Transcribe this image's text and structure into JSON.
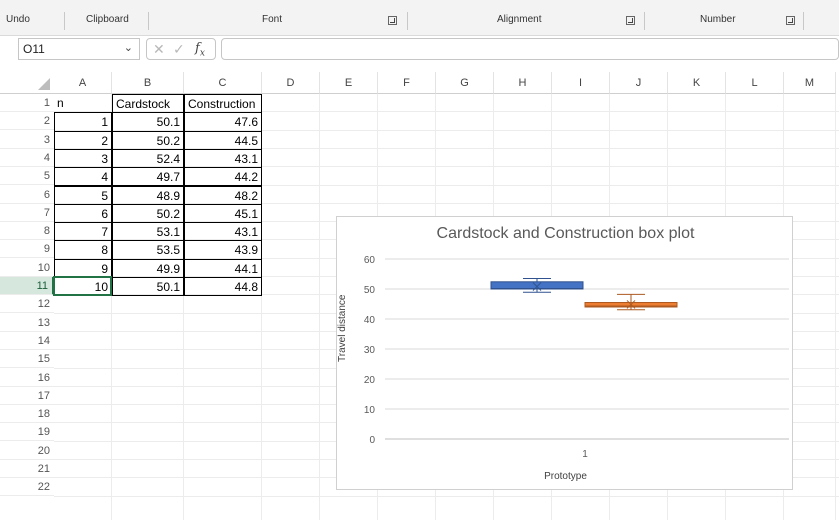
{
  "ribbon": {
    "groups": [
      "Undo",
      "Clipboard",
      "Font",
      "Alignment",
      "Number"
    ]
  },
  "formula_bar": {
    "name_box": "O11",
    "fx_label": "fx",
    "formula": ""
  },
  "columns": [
    "A",
    "B",
    "C",
    "D",
    "E",
    "F",
    "G",
    "H",
    "I",
    "J",
    "K",
    "L",
    "M"
  ],
  "rows": [
    "1",
    "2",
    "3",
    "4",
    "5",
    "6",
    "7",
    "8",
    "9",
    "10",
    "11",
    "12",
    "13",
    "14",
    "15",
    "16",
    "17",
    "18",
    "19",
    "20",
    "21",
    "22"
  ],
  "active_row": "11",
  "table": {
    "headers": [
      "n",
      "Cardstock",
      "Construction"
    ],
    "rows": [
      [
        "1",
        "50.1",
        "47.6"
      ],
      [
        "2",
        "50.2",
        "44.5"
      ],
      [
        "3",
        "52.4",
        "43.1"
      ],
      [
        "4",
        "49.7",
        "44.2"
      ],
      [
        "5",
        "48.9",
        "48.2"
      ],
      [
        "6",
        "50.2",
        "45.1"
      ],
      [
        "7",
        "53.1",
        "43.1"
      ],
      [
        "8",
        "53.5",
        "43.9"
      ],
      [
        "9",
        "49.9",
        "44.1"
      ],
      [
        "10",
        "50.1",
        "44.8"
      ]
    ]
  },
  "chart_data": {
    "type": "box",
    "title": "Cardstock and Construction box plot",
    "xlabel": "Prototype",
    "ylabel": "Travel distance",
    "ylim": [
      0,
      60
    ],
    "yticks": [
      "0",
      "10",
      "20",
      "30",
      "40",
      "50",
      "60"
    ],
    "categories": [
      "1"
    ],
    "grid": true,
    "series": [
      {
        "name": "Cardstock",
        "color": "#4472C4",
        "min": 48.9,
        "q1": 50.0,
        "median": 50.15,
        "q3": 52.4,
        "max": 53.5,
        "mean": 50.81
      },
      {
        "name": "Construction",
        "color": "#ED7D31",
        "min": 43.1,
        "q1": 44.0,
        "median": 44.35,
        "q3": 45.5,
        "max": 48.2,
        "mean": 44.86
      }
    ]
  }
}
